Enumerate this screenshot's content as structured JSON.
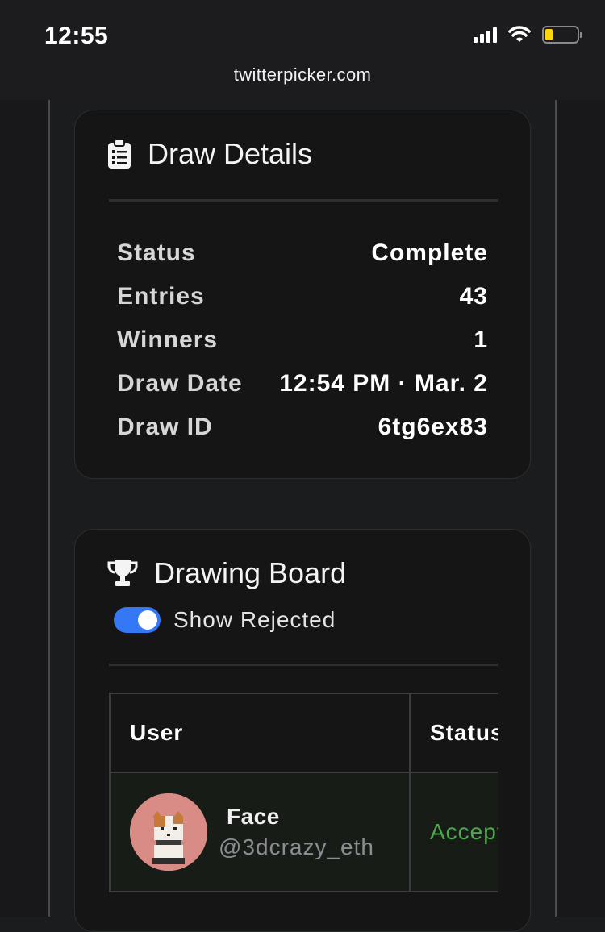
{
  "status_bar": {
    "time": "12:55"
  },
  "browser": {
    "url": "twitterpicker.com"
  },
  "draw_details": {
    "title": "Draw Details",
    "rows": [
      {
        "key": "Status",
        "value": "Complete"
      },
      {
        "key": "Entries",
        "value": "43"
      },
      {
        "key": "Winners",
        "value": "1"
      },
      {
        "key": "Draw Date",
        "value": "12:54 PM · Mar. 2"
      },
      {
        "key": "Draw ID",
        "value": "6tg6ex83"
      }
    ]
  },
  "drawing_board": {
    "title": "Drawing Board",
    "toggle_label": "Show Rejected",
    "show_rejected": true,
    "columns": [
      "User",
      "Status"
    ],
    "entries": [
      {
        "name": "Face",
        "handle": "@3dcrazy_eth",
        "status": "Accepted"
      }
    ]
  },
  "colors": {
    "accent": "#3478f6",
    "accepted": "#4fa84f",
    "battery": "#ffd60a"
  },
  "icons": [
    "clipboard-icon",
    "trophy-icon",
    "wifi-icon",
    "signal-icon",
    "battery-icon"
  ]
}
